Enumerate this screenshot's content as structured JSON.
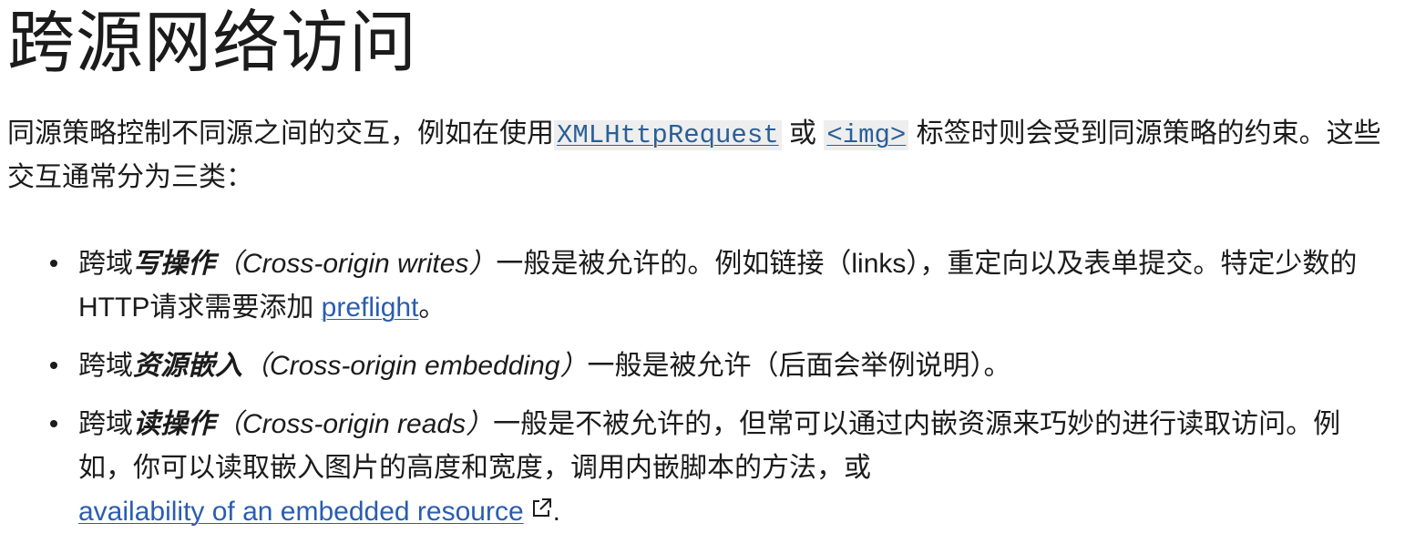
{
  "title": "跨源网络访问",
  "intro": {
    "text_before": "同源策略控制不同源之间的交互，例如在使用",
    "code1": "XMLHttpRequest",
    "text_or": " 或 ",
    "code2": "<img>",
    "text_after": " 标签时则会受到同源策略的约束。这些交互通常分为三类："
  },
  "items": [
    {
      "prefix": "跨域",
      "bold": "写操作",
      "paren": "（Cross-origin writes）",
      "rest": "一般是被允许的。例如链接（links），重定向以及表单提交。特定少数的HTTP请求需要添加 ",
      "link": "preflight",
      "end": "。"
    },
    {
      "prefix": "跨域",
      "bold": "资源嵌入",
      "paren": "（Cross-origin embedding）",
      "rest": "一般是被允许（后面会举例说明）。"
    },
    {
      "prefix": "跨域",
      "bold": "读操作",
      "paren": "（Cross-origin reads）",
      "rest": "一般是不被允许的，但常可以通过内嵌资源来巧妙的进行读取访问。例如，你可以读取嵌入图片的高度和宽度，调用内嵌脚本的方法，或",
      "link": "availability of an embedded resource",
      "end": "."
    }
  ],
  "icons": {
    "external_link": "external-link-icon"
  },
  "colors": {
    "text": "#1b1b1b",
    "link": "#2a5db0",
    "code_bg": "#eeeeee"
  }
}
